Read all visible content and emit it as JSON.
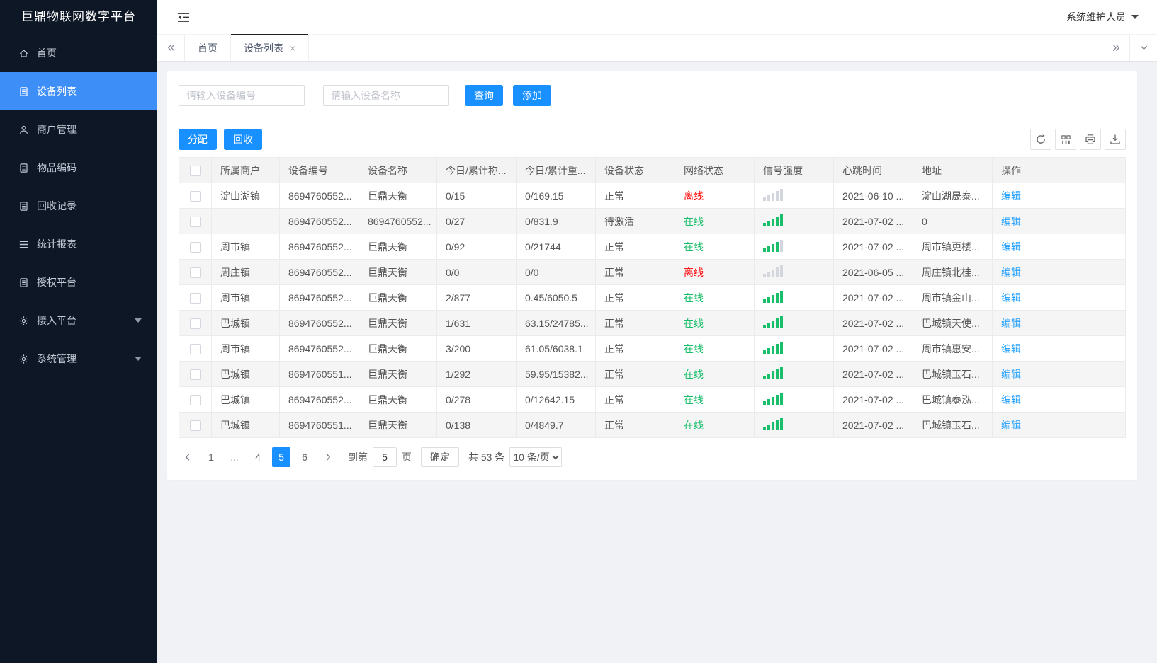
{
  "app": {
    "title": "巨鼎物联网数字平台",
    "user": "系统维护人员"
  },
  "sidebar": {
    "items": [
      {
        "key": "home",
        "icon": "home-icon",
        "label": "首页"
      },
      {
        "key": "device-list",
        "icon": "doc-icon",
        "label": "设备列表",
        "active": true
      },
      {
        "key": "merchant-mgmt",
        "icon": "user-icon",
        "label": "商户管理"
      },
      {
        "key": "item-code",
        "icon": "doc-icon",
        "label": "物品编码"
      },
      {
        "key": "recycle-records",
        "icon": "doc-icon",
        "label": "回收记录"
      },
      {
        "key": "stats-report",
        "icon": "menu-icon",
        "label": "统计报表"
      },
      {
        "key": "auth-platform",
        "icon": "doc-icon",
        "label": "授权平台"
      },
      {
        "key": "access-platform",
        "icon": "gear-icon",
        "label": "接入平台",
        "expandable": true
      },
      {
        "key": "system-mgmt",
        "icon": "gear-icon",
        "label": "系统管理",
        "expandable": true
      }
    ]
  },
  "tabs": {
    "items": [
      {
        "key": "home",
        "label": "首页"
      },
      {
        "key": "device-list",
        "label": "设备列表",
        "active": true,
        "closable": true
      }
    ]
  },
  "search": {
    "device_no_placeholder": "请输入设备编号",
    "device_name_placeholder": "请输入设备名称",
    "query_label": "查询",
    "add_label": "添加"
  },
  "toolbar": {
    "assign_label": "分配",
    "recycle_label": "回收"
  },
  "table": {
    "edit_label": "编辑",
    "columns": [
      "所属商户",
      "设备编号",
      "设备名称",
      "今日/累计称...",
      "今日/累计重...",
      "设备状态",
      "网络状态",
      "信号强度",
      "心跳时间",
      "地址",
      "操作"
    ],
    "rows": [
      {
        "merchant": "淀山湖镇",
        "device_no": "8694760552...",
        "device_name": "巨鼎天衡",
        "count": "0/15",
        "weight": "0/169.15",
        "status": "正常",
        "network": "离线",
        "network_state": "offline",
        "signal": 0,
        "heartbeat": "2021-06-10 ...",
        "address": "淀山湖晟泰..."
      },
      {
        "merchant": "",
        "device_no": "8694760552...",
        "device_name": "8694760552...",
        "count": "0/27",
        "weight": "0/831.9",
        "status": "待激活",
        "network": "在线",
        "network_state": "online",
        "signal": 5,
        "heartbeat": "2021-07-02 ...",
        "address": "0"
      },
      {
        "merchant": "周市镇",
        "device_no": "8694760552...",
        "device_name": "巨鼎天衡",
        "count": "0/92",
        "weight": "0/21744",
        "status": "正常",
        "network": "在线",
        "network_state": "online",
        "signal": 4,
        "heartbeat": "2021-07-02 ...",
        "address": "周市镇更楼..."
      },
      {
        "merchant": "周庄镇",
        "device_no": "8694760552...",
        "device_name": "巨鼎天衡",
        "count": "0/0",
        "weight": "0/0",
        "status": "正常",
        "network": "离线",
        "network_state": "offline",
        "signal": 0,
        "heartbeat": "2021-06-05 ...",
        "address": "周庄镇北桂..."
      },
      {
        "merchant": "周市镇",
        "device_no": "8694760552...",
        "device_name": "巨鼎天衡",
        "count": "2/877",
        "weight": "0.45/6050.5",
        "status": "正常",
        "network": "在线",
        "network_state": "online",
        "signal": 5,
        "heartbeat": "2021-07-02 ...",
        "address": "周市镇金山..."
      },
      {
        "merchant": "巴城镇",
        "device_no": "8694760552...",
        "device_name": "巨鼎天衡",
        "count": "1/631",
        "weight": "63.15/24785...",
        "status": "正常",
        "network": "在线",
        "network_state": "online",
        "signal": 5,
        "heartbeat": "2021-07-02 ...",
        "address": "巴城镇天使..."
      },
      {
        "merchant": "周市镇",
        "device_no": "8694760552...",
        "device_name": "巨鼎天衡",
        "count": "3/200",
        "weight": "61.05/6038.1",
        "status": "正常",
        "network": "在线",
        "network_state": "online",
        "signal": 5,
        "heartbeat": "2021-07-02 ...",
        "address": "周市镇惠安..."
      },
      {
        "merchant": "巴城镇",
        "device_no": "8694760551...",
        "device_name": "巨鼎天衡",
        "count": "1/292",
        "weight": "59.95/15382...",
        "status": "正常",
        "network": "在线",
        "network_state": "online",
        "signal": 5,
        "heartbeat": "2021-07-02 ...",
        "address": "巴城镇玉石..."
      },
      {
        "merchant": "巴城镇",
        "device_no": "8694760552...",
        "device_name": "巨鼎天衡",
        "count": "0/278",
        "weight": "0/12642.15",
        "status": "正常",
        "network": "在线",
        "network_state": "online",
        "signal": 5,
        "heartbeat": "2021-07-02 ...",
        "address": "巴城镇泰泓..."
      },
      {
        "merchant": "巴城镇",
        "device_no": "8694760551...",
        "device_name": "巨鼎天衡",
        "count": "0/138",
        "weight": "0/4849.7",
        "status": "正常",
        "network": "在线",
        "network_state": "online",
        "signal": 5,
        "heartbeat": "2021-07-02 ...",
        "address": "巴城镇玉石..."
      }
    ]
  },
  "pagination": {
    "pages": [
      {
        "t": "1"
      },
      {
        "t": "..."
      },
      {
        "t": "4"
      },
      {
        "t": "5",
        "active": true
      },
      {
        "t": "6"
      }
    ],
    "goto_label": "到第",
    "goto_value": "5",
    "unit_label": "页",
    "confirm_label": "确定",
    "total": "共 53 条",
    "page_size": "10 条/页"
  },
  "colors": {
    "sidebar_active": "#3e8ef7",
    "primary_button": "#1890ff",
    "online": "#19be6b",
    "offline": "#ff0000",
    "link": "#1e9fff"
  }
}
